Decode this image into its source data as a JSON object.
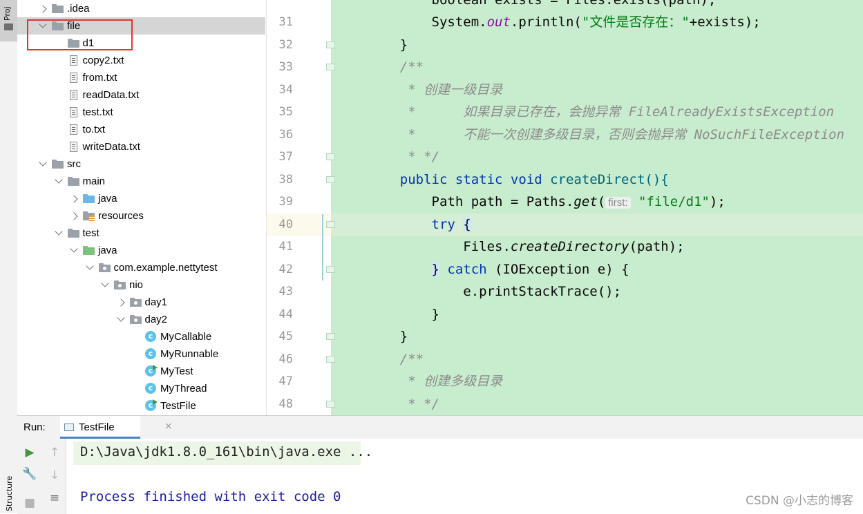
{
  "sidebar": {
    "project_tab": "Proj",
    "structure_tab": "Structure"
  },
  "tree": {
    "items": [
      {
        "label": ".idea",
        "indent": 0,
        "arrow": "right",
        "icon": "folder-grey"
      },
      {
        "label": "file",
        "indent": 0,
        "arrow": "down",
        "icon": "folder-grey",
        "selected": true
      },
      {
        "label": "d1",
        "indent": 1,
        "arrow": "",
        "icon": "folder-grey"
      },
      {
        "label": "copy2.txt",
        "indent": 1,
        "arrow": "",
        "icon": "text-file"
      },
      {
        "label": "from.txt",
        "indent": 1,
        "arrow": "",
        "icon": "text-file"
      },
      {
        "label": "readData.txt",
        "indent": 1,
        "arrow": "",
        "icon": "text-file"
      },
      {
        "label": "test.txt",
        "indent": 1,
        "arrow": "",
        "icon": "text-file"
      },
      {
        "label": "to.txt",
        "indent": 1,
        "arrow": "",
        "icon": "text-file"
      },
      {
        "label": "writeData.txt",
        "indent": 1,
        "arrow": "",
        "icon": "text-file"
      },
      {
        "label": "src",
        "indent": 0,
        "arrow": "down",
        "icon": "folder-grey"
      },
      {
        "label": "main",
        "indent": 1,
        "arrow": "down",
        "icon": "folder-grey"
      },
      {
        "label": "java",
        "indent": 2,
        "arrow": "right",
        "icon": "folder-blue"
      },
      {
        "label": "resources",
        "indent": 2,
        "arrow": "right",
        "icon": "folder-resources"
      },
      {
        "label": "test",
        "indent": 1,
        "arrow": "down",
        "icon": "folder-grey"
      },
      {
        "label": "java",
        "indent": 2,
        "arrow": "down",
        "icon": "folder-green"
      },
      {
        "label": "com.example.nettytest",
        "indent": 3,
        "arrow": "down",
        "icon": "package"
      },
      {
        "label": "nio",
        "indent": 4,
        "arrow": "down",
        "icon": "package"
      },
      {
        "label": "day1",
        "indent": 5,
        "arrow": "right",
        "icon": "package"
      },
      {
        "label": "day2",
        "indent": 5,
        "arrow": "down",
        "icon": "package"
      },
      {
        "label": "MyCallable",
        "indent": 6,
        "arrow": "",
        "icon": "class"
      },
      {
        "label": "MyRunnable",
        "indent": 6,
        "arrow": "",
        "icon": "class"
      },
      {
        "label": "MyTest",
        "indent": 6,
        "arrow": "",
        "icon": "class-run"
      },
      {
        "label": "MyThread",
        "indent": 6,
        "arrow": "",
        "icon": "class"
      },
      {
        "label": "TestFile",
        "indent": 6,
        "arrow": "",
        "icon": "class-run"
      }
    ]
  },
  "editor": {
    "line_numbers": [
      "31",
      "32",
      "33",
      "34",
      "35",
      "36",
      "37",
      "38",
      "39",
      "40",
      "41",
      "42",
      "43",
      "44",
      "45",
      "46",
      "47",
      "48"
    ],
    "partial_top_line": "        boolean exists = Files.exists(path);",
    "code": {
      "l31_a": "        System.",
      "l31_b": "out",
      "l31_c": ".println(",
      "l31_d": "\"文件是否存在：\"",
      "l31_e": "+exists);",
      "l32": "    }",
      "l33": "    /**",
      "l34": "     * 创建一级目录",
      "l35": "     *      如果目录已存在，会抛异常 FileAlreadyExistsException",
      "l36": "     *      不能一次创建多级目录，否则会抛异常 NoSuchFileException",
      "l37": "     * */",
      "l38_kw": "    public static void ",
      "l38_rest": "createDirect(){",
      "l39_a": "        Path path = Paths.",
      "l39_b": "get",
      "l39_c": "(",
      "l39_hint": "first:",
      "l39_d": "\"file/d1\"",
      "l39_e": ");",
      "l40_kw": "        try ",
      "l40_b": "{",
      "l41_a": "            Files.",
      "l41_b": "createDirectory",
      "l41_c": "(path);",
      "l42_a": "        ",
      "l42_b": "}",
      "l42_kw": " catch ",
      "l42_c": "(IOException e) {",
      "l43": "            e.printStackTrace();",
      "l44": "        }",
      "l45": "    }",
      "l46": "    /**",
      "l47": "     * 创建多级目录",
      "l48": "     * */"
    }
  },
  "run": {
    "label": "Run:",
    "tab_label": "TestFile",
    "tab_close": "×",
    "command": "D:\\Java\\jdk1.8.0_161\\bin\\java.exe ...",
    "exit_message": "Process finished with exit code 0"
  },
  "watermark": "CSDN @小志的博客",
  "colors": {
    "keyword": "#0033b3",
    "string": "#067d17",
    "comment": "#8c8c8c",
    "changed_lines_bg": "#c8ecce",
    "selection_box": "#e23333"
  }
}
